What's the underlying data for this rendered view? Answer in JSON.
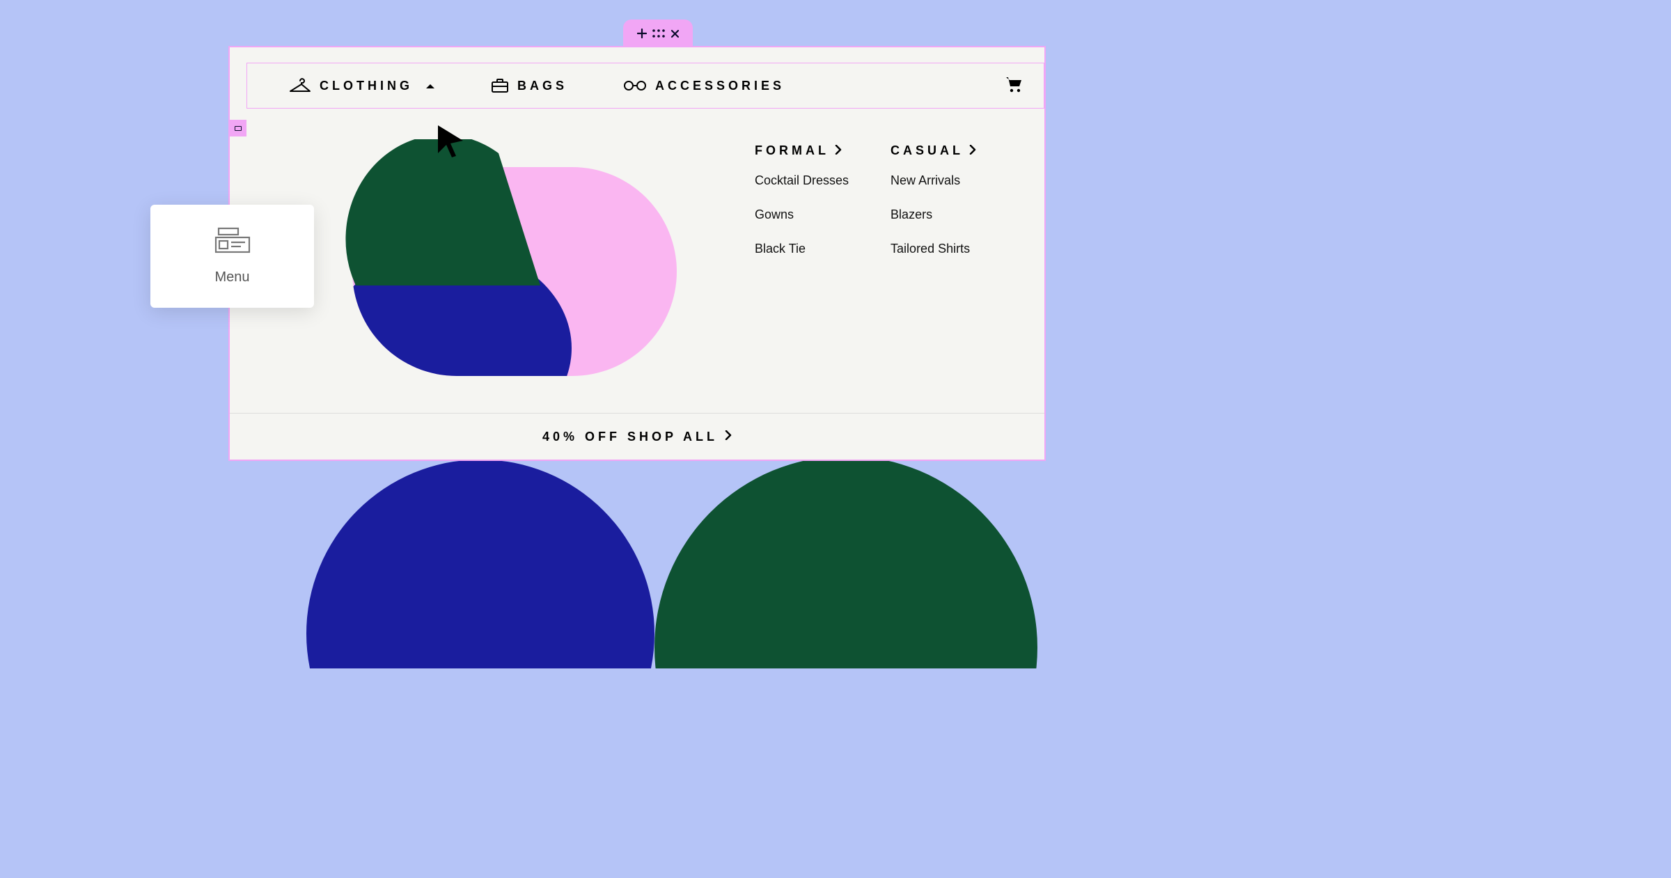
{
  "editor_tab": {
    "add_label": "Add",
    "drag_label": "Drag",
    "close_label": "Close"
  },
  "navbar": {
    "items": [
      {
        "label": "CLOTHING",
        "icon": "hanger",
        "expanded": true
      },
      {
        "label": "BAGS",
        "icon": "briefcase",
        "expanded": false
      },
      {
        "label": "ACCESSORIES",
        "icon": "glasses",
        "expanded": false
      }
    ],
    "cart_label": "Cart"
  },
  "mega_menu": {
    "columns": [
      {
        "header": "FORMAL",
        "items": [
          "Cocktail Dresses",
          "Gowns",
          "Black Tie"
        ]
      },
      {
        "header": "CASUAL",
        "items": [
          "New Arrivals",
          "Blazers",
          "Tailored Shirts"
        ]
      }
    ]
  },
  "banner": {
    "text": "40% OFF SHOP ALL"
  },
  "block_panel": {
    "label": "Menu"
  },
  "colors": {
    "stage": "#b5c4f7",
    "selection": "#f1a6f5",
    "canvas": "#f5f5f2",
    "green": "#0e5232",
    "blue": "#1a1d9e",
    "pink": "#fab6f1"
  }
}
